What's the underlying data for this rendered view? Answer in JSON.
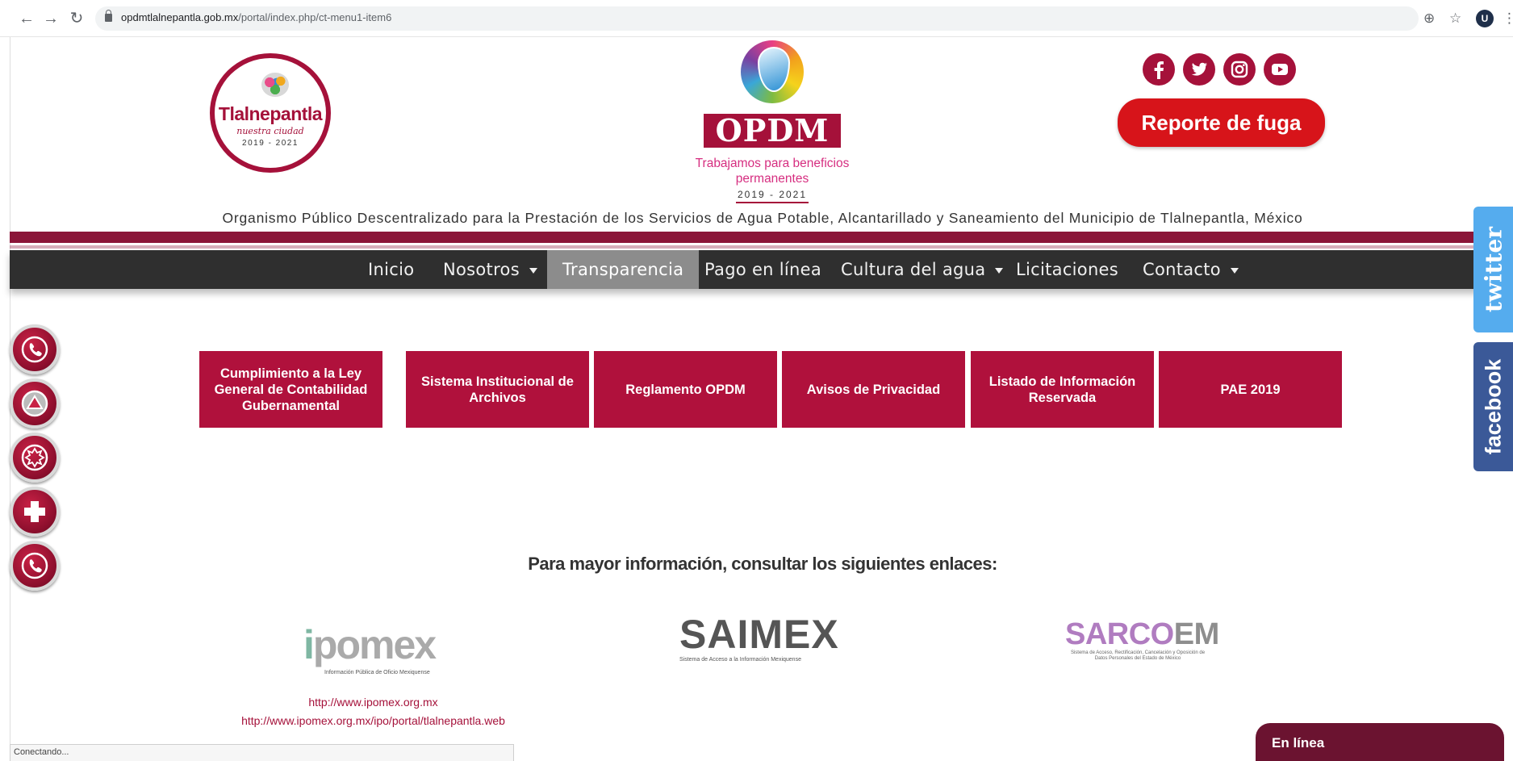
{
  "browser": {
    "url_host": "opdmtlalnepantla.gob.mx",
    "url_path": "/portal/index.php/ct-menu1-item6",
    "profile_initial": "U"
  },
  "header": {
    "tlalnepantla_logo": {
      "name": "Tlalnepantla",
      "tagline": "nuestra ciudad",
      "years": "2019 - 2021"
    },
    "opdm_logo": {
      "name": "OPDM",
      "tagline": "Trabajamos para beneficios permanentes",
      "years": "2019 - 2021"
    },
    "social": [
      {
        "name": "facebook",
        "icon": "facebook-icon"
      },
      {
        "name": "twitter",
        "icon": "twitter-icon"
      },
      {
        "name": "instagram",
        "icon": "instagram-icon"
      },
      {
        "name": "youtube",
        "icon": "youtube-icon"
      }
    ],
    "report_button": "Reporte de fuga",
    "org_name": "Organismo Público Descentralizado para la Prestación de los Servicios de Agua Potable, Alcantarillado y Saneamiento del Municipio de Tlalnepantla, México"
  },
  "nav": {
    "items": [
      {
        "label": "Inicio"
      },
      {
        "label": "Nosotros"
      },
      {
        "label": "Transparencia"
      },
      {
        "label": "Pago en línea"
      },
      {
        "label": "Cultura del agua"
      },
      {
        "label": "Licitaciones"
      },
      {
        "label": "Contacto"
      }
    ],
    "active": "Transparencia"
  },
  "side_icons": [
    "phone-icon",
    "alert-icon",
    "fire-icon",
    "medical-cross-icon",
    "phone-icon"
  ],
  "side_tabs": {
    "twitter": "twitter",
    "facebook": "facebook"
  },
  "transparency_buttons": [
    "Cumplimiento a la Ley General de Contabilidad Gubernamental",
    "Sistema Institucional de Archivos",
    "Reglamento OPDM",
    "Avisos de Privacidad",
    "Listado de Información Reservada",
    "PAE 2019"
  ],
  "more_info": "Para mayor información, consultar los siguientes enlaces:",
  "partners": {
    "ipomex": {
      "word_i": "i",
      "word_rest": "pomex",
      "caption": "Información Pública de Oficio Mexiquense"
    },
    "saimex": {
      "word": "SAIMEX",
      "caption": "Sistema de Acceso a la Información Mexiquense"
    },
    "sarcoem": {
      "word_a": "SARCO",
      "word_b": "EM",
      "caption": "Sistema de Acceso, Rectificación, Cancelación y Oposición de Datos Personales del Estado de México"
    }
  },
  "links": {
    "ipomex_url": "http://www.ipomex.org.mx",
    "ipomex_portal_url": "http://www.ipomex.org.mx/ipo/portal/tlalnepantla.web"
  },
  "status": "Conectando...",
  "chat": "En línea",
  "colors": {
    "brand": "#a5113a",
    "nav": "#2f2f2f",
    "nav_active": "#8c8c8c",
    "report": "#d7141a",
    "twitter": "#55acee",
    "facebook": "#3b5998"
  }
}
